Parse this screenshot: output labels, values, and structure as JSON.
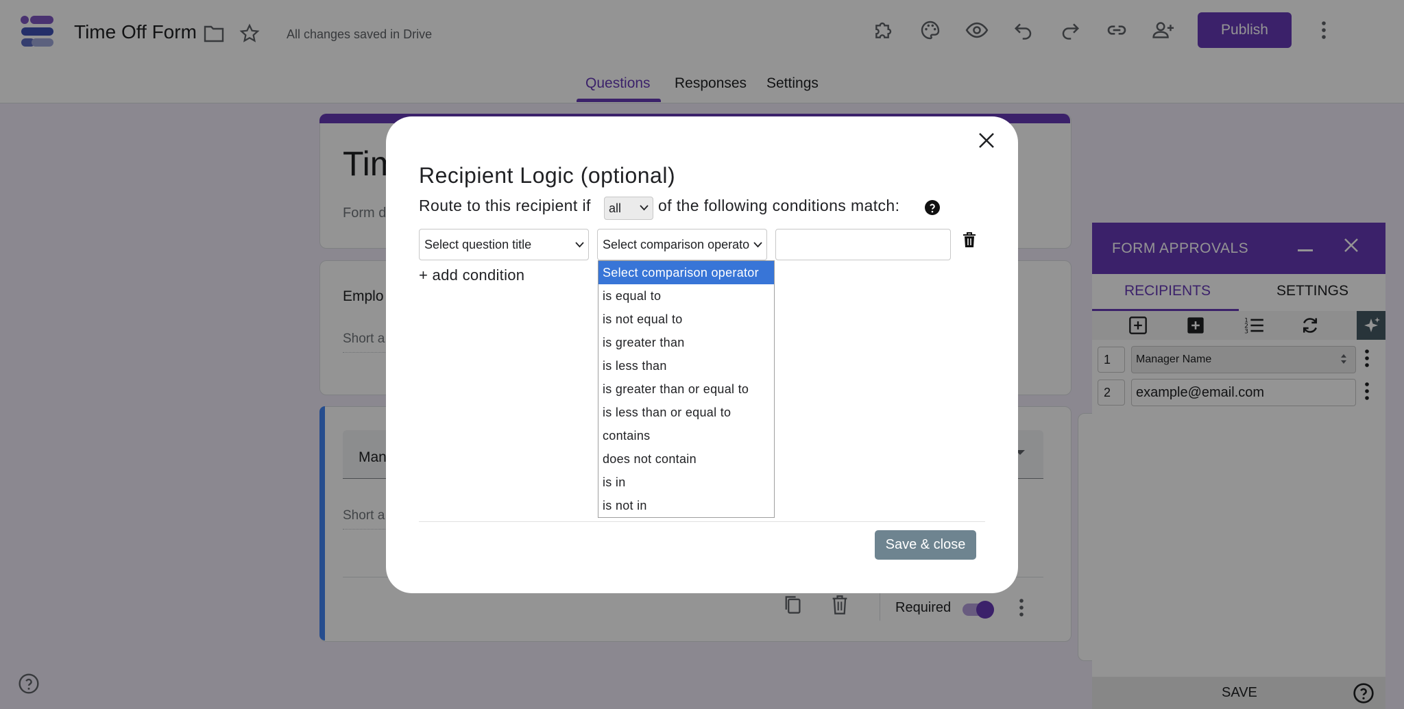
{
  "header": {
    "title": "Time Off Form",
    "save_status": "All changes saved in Drive",
    "publish_label": "Publish",
    "tabs": [
      "Questions",
      "Responses",
      "Settings"
    ]
  },
  "form": {
    "title_partial": "Tim",
    "description_partial": "Form d",
    "q1_label_partial": "Emplo",
    "q1_answer_partial": "Short a",
    "q2_select_partial": "Man",
    "q2_answer_partial": "Short a",
    "required_label": "Required"
  },
  "panel": {
    "title": "FORM APPROVALS",
    "tabs": [
      "RECIPIENTS",
      "SETTINGS"
    ],
    "rows": [
      {
        "num": "1",
        "value": "Manager Name"
      },
      {
        "num": "2",
        "value": "example@email.com"
      }
    ],
    "save_label": "SAVE"
  },
  "modal": {
    "title": "Recipient Logic (optional)",
    "route_prefix": "Route to this recipient if",
    "match_select": "all",
    "route_suffix": "of the following conditions match:",
    "question_select": "Select question title",
    "operator_select": "Select comparison operator",
    "add_condition": "+ add condition",
    "operator_options": [
      "Select comparison operator",
      "is equal to",
      "is not equal to",
      "is greater than",
      "is less than",
      "is greater than or equal to",
      "is less than or equal to",
      "contains",
      "does not contain",
      "is in",
      "is not in"
    ],
    "save_close": "Save & close"
  },
  "colors": {
    "brand": "#673ab7",
    "accent_blue": "#4285f4",
    "selected_option": "#3875d7",
    "save_close_bg": "#6e8490"
  }
}
